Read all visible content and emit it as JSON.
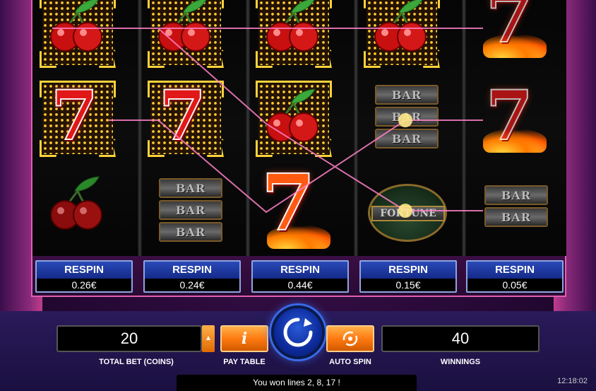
{
  "reels": [
    {
      "respin_label": "RESPIN",
      "respin_price": "0.26€"
    },
    {
      "respin_label": "RESPIN",
      "respin_price": "0.24€"
    },
    {
      "respin_label": "RESPIN",
      "respin_price": "0.44€"
    },
    {
      "respin_label": "RESPIN",
      "respin_price": "0.15€"
    },
    {
      "respin_label": "RESPIN",
      "respin_price": "0.05€"
    }
  ],
  "symbols": {
    "seven": "7",
    "bar": "BAR",
    "fortune": "FORTUNE"
  },
  "controls": {
    "total_bet_value": "20",
    "total_bet_label": "TOTAL BET (COINS)",
    "pay_table_label": "PAY TABLE",
    "pay_table_icon": "i",
    "auto_spin_label": "AUTO SPIN",
    "winnings_value": "40",
    "winnings_label": "WINNINGS",
    "bet_arrow": "▲"
  },
  "status_message": "You won lines 2, 8, 17 !",
  "clock": "12:18:02",
  "colors": {
    "accent_pink": "#e060b0",
    "respin_blue": "#2a4ab8",
    "orange": "#ff7a10",
    "spin_blue": "#2a5ad8"
  }
}
